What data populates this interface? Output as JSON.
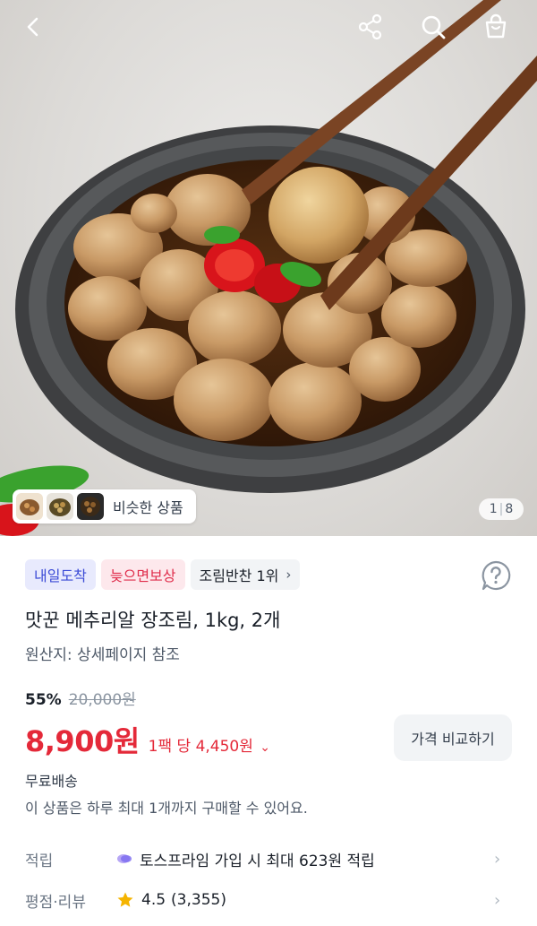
{
  "header": {
    "back_icon": "chevron-left-icon",
    "share_icon": "share-icon",
    "search_icon": "search-icon",
    "bag_icon": "shopping-bag-icon"
  },
  "gallery": {
    "similar_label": "비슷한 상품",
    "current": "1",
    "total": "8"
  },
  "badges": [
    {
      "label": "내일도착"
    },
    {
      "label": "늦으면보상"
    },
    {
      "label": "조림반찬 1위"
    }
  ],
  "product": {
    "title": "맛꾼 메추리알 장조림, 1kg, 2개",
    "origin": "원산지: 상세페이지 참조",
    "discount": "55%",
    "original_price": "20,000원",
    "price": "8,900원",
    "unit_price": "1팩 당 4,450원",
    "compare_button": "가격 비교하기",
    "shipping": "무료배송",
    "limit_notice": "이 상품은 하루 최대 1개까지 구매할 수 있어요."
  },
  "details": {
    "points_label": "적립",
    "points_value": "토스프라임 가입 시 최대 623원 적립",
    "review_label": "평점·리뷰",
    "rating": "4.5",
    "review_count": "(3,355)"
  },
  "colors": {
    "price_red": "#e42939",
    "badge_blue": "#3b4bd6",
    "badge_red": "#e02e4c",
    "star": "#f5b400"
  }
}
